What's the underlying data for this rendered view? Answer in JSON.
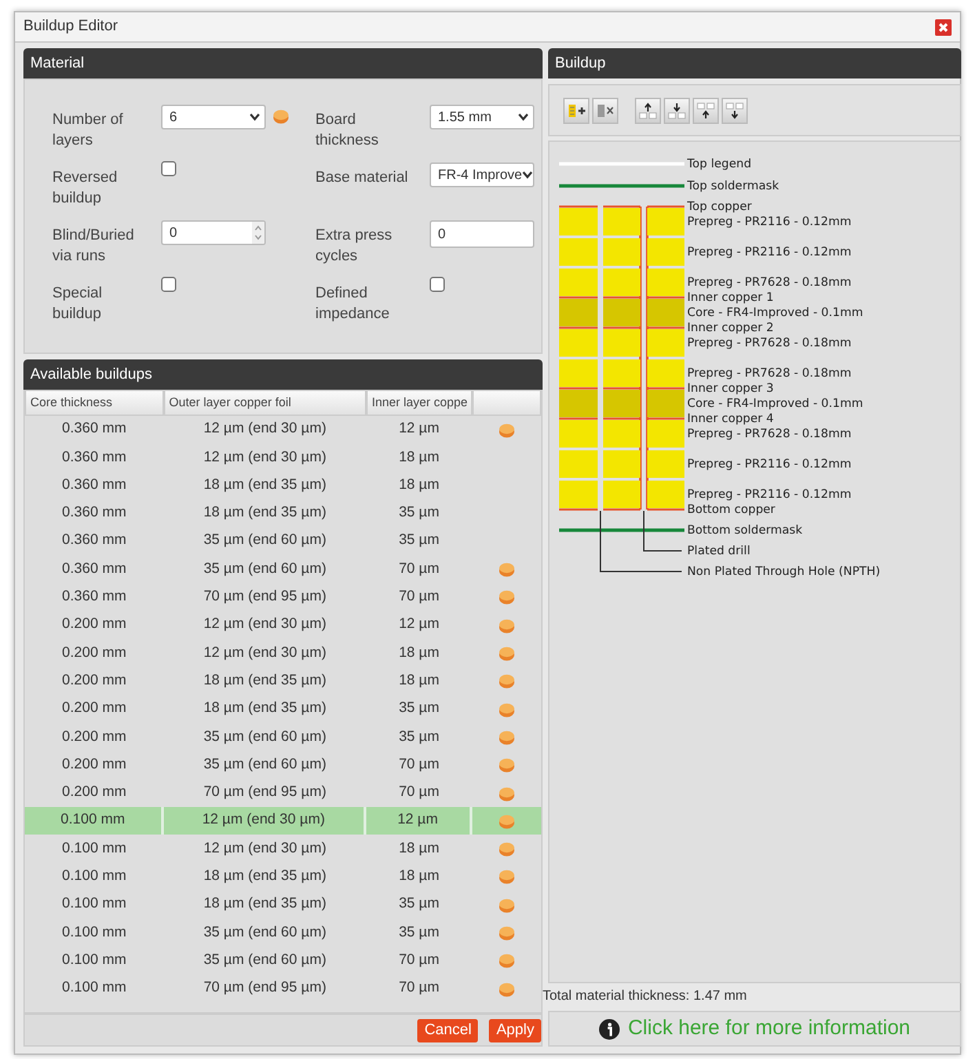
{
  "window": {
    "title": "Buildup Editor"
  },
  "material": {
    "title": "Material",
    "fields": [
      {
        "label": "Number of layers",
        "kind": "select",
        "value": "6",
        "coin": true
      },
      {
        "label": "Board thickness",
        "kind": "select",
        "value": "1.55 mm"
      },
      {
        "label": "Reversed buildup",
        "kind": "checkbox",
        "checked": false
      },
      {
        "label": "Base material",
        "kind": "select",
        "value": "FR-4 Improve"
      },
      {
        "label": "Blind/Buried via runs",
        "kind": "number",
        "value": "0"
      },
      {
        "label": "Extra press cycles",
        "kind": "text",
        "value": "0"
      },
      {
        "label": "Special buildup",
        "kind": "checkbox",
        "checked": false
      },
      {
        "label": "Defined impedance",
        "kind": "checkbox",
        "checked": false
      }
    ]
  },
  "available_buildups": {
    "title": "Available buildups",
    "columns": [
      "Core thickness",
      "Outer layer copper foil",
      "Inner layer coppe"
    ],
    "rows": [
      {
        "core": "0.360 mm",
        "outer": "12 µm (end 30 µm)",
        "inner": "12 µm",
        "coin": true,
        "selected": false
      },
      {
        "core": "0.360 mm",
        "outer": "12 µm (end 30 µm)",
        "inner": "18 µm",
        "coin": false,
        "selected": false
      },
      {
        "core": "0.360 mm",
        "outer": "18 µm (end 35 µm)",
        "inner": "18 µm",
        "coin": false,
        "selected": false
      },
      {
        "core": "0.360 mm",
        "outer": "18 µm (end 35 µm)",
        "inner": "35 µm",
        "coin": false,
        "selected": false
      },
      {
        "core": "0.360 mm",
        "outer": "35 µm (end 60 µm)",
        "inner": "35 µm",
        "coin": false,
        "selected": false
      },
      {
        "core": "0.360 mm",
        "outer": "35 µm (end 60 µm)",
        "inner": "70 µm",
        "coin": true,
        "selected": false
      },
      {
        "core": "0.360 mm",
        "outer": "70 µm (end 95 µm)",
        "inner": "70 µm",
        "coin": true,
        "selected": false
      },
      {
        "core": "0.200 mm",
        "outer": "12 µm (end 30 µm)",
        "inner": "12 µm",
        "coin": true,
        "selected": false
      },
      {
        "core": "0.200 mm",
        "outer": "12 µm (end 30 µm)",
        "inner": "18 µm",
        "coin": true,
        "selected": false
      },
      {
        "core": "0.200 mm",
        "outer": "18 µm (end 35 µm)",
        "inner": "18 µm",
        "coin": true,
        "selected": false
      },
      {
        "core": "0.200 mm",
        "outer": "18 µm (end 35 µm)",
        "inner": "35 µm",
        "coin": true,
        "selected": false
      },
      {
        "core": "0.200 mm",
        "outer": "35 µm (end 60 µm)",
        "inner": "35 µm",
        "coin": true,
        "selected": false
      },
      {
        "core": "0.200 mm",
        "outer": "35 µm (end 60 µm)",
        "inner": "70 µm",
        "coin": true,
        "selected": false
      },
      {
        "core": "0.200 mm",
        "outer": "70 µm (end 95 µm)",
        "inner": "70 µm",
        "coin": true,
        "selected": false
      },
      {
        "core": "0.100 mm",
        "outer": "12 µm (end 30 µm)",
        "inner": "12 µm",
        "coin": true,
        "selected": true
      },
      {
        "core": "0.100 mm",
        "outer": "12 µm (end 30 µm)",
        "inner": "18 µm",
        "coin": true,
        "selected": false
      },
      {
        "core": "0.100 mm",
        "outer": "18 µm (end 35 µm)",
        "inner": "18 µm",
        "coin": true,
        "selected": false
      },
      {
        "core": "0.100 mm",
        "outer": "18 µm (end 35 µm)",
        "inner": "35 µm",
        "coin": true,
        "selected": false
      },
      {
        "core": "0.100 mm",
        "outer": "35 µm (end 60 µm)",
        "inner": "35 µm",
        "coin": true,
        "selected": false
      },
      {
        "core": "0.100 mm",
        "outer": "35 µm (end 60 µm)",
        "inner": "70 µm",
        "coin": true,
        "selected": false
      },
      {
        "core": "0.100 mm",
        "outer": "70 µm (end 95 µm)",
        "inner": "70 µm",
        "coin": true,
        "selected": false
      }
    ]
  },
  "footer_buttons": [
    {
      "label": "Cancel"
    },
    {
      "label": "Apply"
    }
  ],
  "buildup": {
    "title": "Buildup",
    "layers": [
      {
        "kind": "legend",
        "label": "Top legend"
      },
      {
        "kind": "soldermask",
        "label": "Top soldermask"
      },
      {
        "kind": "copper",
        "label": "Top copper"
      },
      {
        "kind": "prepreg",
        "label": "Prepreg - PR2116 - 0.12mm"
      },
      {
        "kind": "prepreg",
        "label": "Prepreg - PR2116 - 0.12mm"
      },
      {
        "kind": "prepreg",
        "label": "Prepreg - PR7628 - 0.18mm"
      },
      {
        "kind": "copper",
        "label": "Inner copper 1"
      },
      {
        "kind": "core",
        "label": "Core - FR4-Improved - 0.1mm"
      },
      {
        "kind": "copper",
        "label": "Inner copper 2"
      },
      {
        "kind": "prepreg",
        "label": "Prepreg - PR7628 - 0.18mm"
      },
      {
        "kind": "prepreg",
        "label": "Prepreg - PR7628 - 0.18mm"
      },
      {
        "kind": "copper",
        "label": "Inner copper 3"
      },
      {
        "kind": "core",
        "label": "Core - FR4-Improved - 0.1mm"
      },
      {
        "kind": "copper",
        "label": "Inner copper 4"
      },
      {
        "kind": "prepreg",
        "label": "Prepreg - PR7628 - 0.18mm"
      },
      {
        "kind": "prepreg",
        "label": "Prepreg - PR2116 - 0.12mm"
      },
      {
        "kind": "prepreg",
        "label": "Prepreg - PR2116 - 0.12mm"
      },
      {
        "kind": "copper",
        "label": "Bottom copper"
      },
      {
        "kind": "soldermask",
        "label": "Bottom soldermask"
      }
    ],
    "drills": [
      {
        "kind": "plated",
        "label": "Plated drill"
      },
      {
        "kind": "npth",
        "label": "Non Plated Through Hole (NPTH)"
      }
    ],
    "total": "Total material thickness: 1.47 mm"
  },
  "info_link": "Click here for more information"
}
